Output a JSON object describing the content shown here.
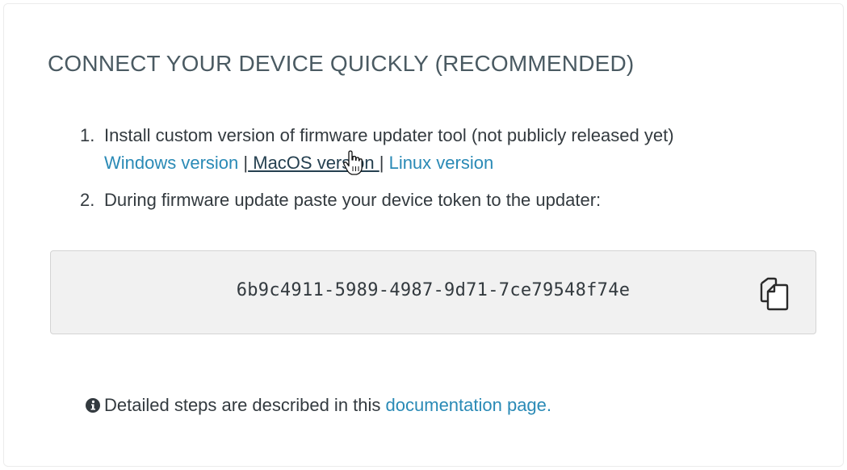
{
  "section": {
    "title": "CONNECT YOUR DEVICE QUICKLY (RECOMMENDED)"
  },
  "steps": [
    {
      "number": "1.",
      "text": "Install custom version of firmware updater tool (not publicly released yet)",
      "links": [
        {
          "label": "Windows version"
        },
        {
          "label": " MacOS version "
        },
        {
          "label": "Linux version"
        }
      ],
      "separator": "|"
    },
    {
      "number": "2.",
      "text": "During firmware update paste your device token to the updater:"
    }
  ],
  "token": {
    "value": "6b9c4911-5989-4987-9d71-7ce79548f74e",
    "copy_icon": "copy-icon"
  },
  "note": {
    "icon": "info-circle-icon",
    "text": "Detailed steps are described in this ",
    "link_label": "documentation page."
  },
  "colors": {
    "link": "#2a8ab6",
    "title": "#4a5a62",
    "token_bg": "#f1f1f1"
  }
}
